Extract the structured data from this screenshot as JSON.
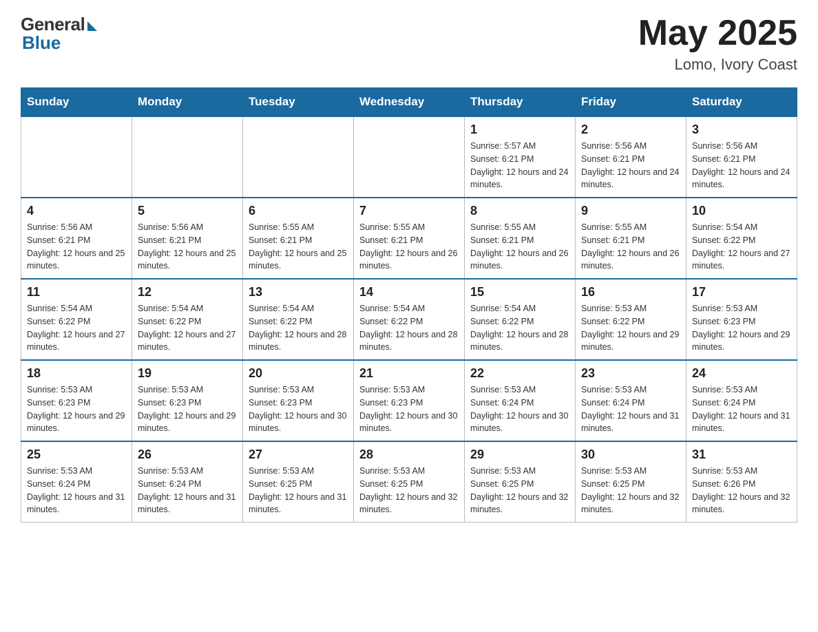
{
  "header": {
    "logo_general": "General",
    "logo_blue": "Blue",
    "month_year": "May 2025",
    "location": "Lomo, Ivory Coast"
  },
  "weekdays": [
    "Sunday",
    "Monday",
    "Tuesday",
    "Wednesday",
    "Thursday",
    "Friday",
    "Saturday"
  ],
  "weeks": [
    [
      {
        "day": "",
        "sunrise": "",
        "sunset": "",
        "daylight": ""
      },
      {
        "day": "",
        "sunrise": "",
        "sunset": "",
        "daylight": ""
      },
      {
        "day": "",
        "sunrise": "",
        "sunset": "",
        "daylight": ""
      },
      {
        "day": "",
        "sunrise": "",
        "sunset": "",
        "daylight": ""
      },
      {
        "day": "1",
        "sunrise": "Sunrise: 5:57 AM",
        "sunset": "Sunset: 6:21 PM",
        "daylight": "Daylight: 12 hours and 24 minutes."
      },
      {
        "day": "2",
        "sunrise": "Sunrise: 5:56 AM",
        "sunset": "Sunset: 6:21 PM",
        "daylight": "Daylight: 12 hours and 24 minutes."
      },
      {
        "day": "3",
        "sunrise": "Sunrise: 5:56 AM",
        "sunset": "Sunset: 6:21 PM",
        "daylight": "Daylight: 12 hours and 24 minutes."
      }
    ],
    [
      {
        "day": "4",
        "sunrise": "Sunrise: 5:56 AM",
        "sunset": "Sunset: 6:21 PM",
        "daylight": "Daylight: 12 hours and 25 minutes."
      },
      {
        "day": "5",
        "sunrise": "Sunrise: 5:56 AM",
        "sunset": "Sunset: 6:21 PM",
        "daylight": "Daylight: 12 hours and 25 minutes."
      },
      {
        "day": "6",
        "sunrise": "Sunrise: 5:55 AM",
        "sunset": "Sunset: 6:21 PM",
        "daylight": "Daylight: 12 hours and 25 minutes."
      },
      {
        "day": "7",
        "sunrise": "Sunrise: 5:55 AM",
        "sunset": "Sunset: 6:21 PM",
        "daylight": "Daylight: 12 hours and 26 minutes."
      },
      {
        "day": "8",
        "sunrise": "Sunrise: 5:55 AM",
        "sunset": "Sunset: 6:21 PM",
        "daylight": "Daylight: 12 hours and 26 minutes."
      },
      {
        "day": "9",
        "sunrise": "Sunrise: 5:55 AM",
        "sunset": "Sunset: 6:21 PM",
        "daylight": "Daylight: 12 hours and 26 minutes."
      },
      {
        "day": "10",
        "sunrise": "Sunrise: 5:54 AM",
        "sunset": "Sunset: 6:22 PM",
        "daylight": "Daylight: 12 hours and 27 minutes."
      }
    ],
    [
      {
        "day": "11",
        "sunrise": "Sunrise: 5:54 AM",
        "sunset": "Sunset: 6:22 PM",
        "daylight": "Daylight: 12 hours and 27 minutes."
      },
      {
        "day": "12",
        "sunrise": "Sunrise: 5:54 AM",
        "sunset": "Sunset: 6:22 PM",
        "daylight": "Daylight: 12 hours and 27 minutes."
      },
      {
        "day": "13",
        "sunrise": "Sunrise: 5:54 AM",
        "sunset": "Sunset: 6:22 PM",
        "daylight": "Daylight: 12 hours and 28 minutes."
      },
      {
        "day": "14",
        "sunrise": "Sunrise: 5:54 AM",
        "sunset": "Sunset: 6:22 PM",
        "daylight": "Daylight: 12 hours and 28 minutes."
      },
      {
        "day": "15",
        "sunrise": "Sunrise: 5:54 AM",
        "sunset": "Sunset: 6:22 PM",
        "daylight": "Daylight: 12 hours and 28 minutes."
      },
      {
        "day": "16",
        "sunrise": "Sunrise: 5:53 AM",
        "sunset": "Sunset: 6:22 PM",
        "daylight": "Daylight: 12 hours and 29 minutes."
      },
      {
        "day": "17",
        "sunrise": "Sunrise: 5:53 AM",
        "sunset": "Sunset: 6:23 PM",
        "daylight": "Daylight: 12 hours and 29 minutes."
      }
    ],
    [
      {
        "day": "18",
        "sunrise": "Sunrise: 5:53 AM",
        "sunset": "Sunset: 6:23 PM",
        "daylight": "Daylight: 12 hours and 29 minutes."
      },
      {
        "day": "19",
        "sunrise": "Sunrise: 5:53 AM",
        "sunset": "Sunset: 6:23 PM",
        "daylight": "Daylight: 12 hours and 29 minutes."
      },
      {
        "day": "20",
        "sunrise": "Sunrise: 5:53 AM",
        "sunset": "Sunset: 6:23 PM",
        "daylight": "Daylight: 12 hours and 30 minutes."
      },
      {
        "day": "21",
        "sunrise": "Sunrise: 5:53 AM",
        "sunset": "Sunset: 6:23 PM",
        "daylight": "Daylight: 12 hours and 30 minutes."
      },
      {
        "day": "22",
        "sunrise": "Sunrise: 5:53 AM",
        "sunset": "Sunset: 6:24 PM",
        "daylight": "Daylight: 12 hours and 30 minutes."
      },
      {
        "day": "23",
        "sunrise": "Sunrise: 5:53 AM",
        "sunset": "Sunset: 6:24 PM",
        "daylight": "Daylight: 12 hours and 31 minutes."
      },
      {
        "day": "24",
        "sunrise": "Sunrise: 5:53 AM",
        "sunset": "Sunset: 6:24 PM",
        "daylight": "Daylight: 12 hours and 31 minutes."
      }
    ],
    [
      {
        "day": "25",
        "sunrise": "Sunrise: 5:53 AM",
        "sunset": "Sunset: 6:24 PM",
        "daylight": "Daylight: 12 hours and 31 minutes."
      },
      {
        "day": "26",
        "sunrise": "Sunrise: 5:53 AM",
        "sunset": "Sunset: 6:24 PM",
        "daylight": "Daylight: 12 hours and 31 minutes."
      },
      {
        "day": "27",
        "sunrise": "Sunrise: 5:53 AM",
        "sunset": "Sunset: 6:25 PM",
        "daylight": "Daylight: 12 hours and 31 minutes."
      },
      {
        "day": "28",
        "sunrise": "Sunrise: 5:53 AM",
        "sunset": "Sunset: 6:25 PM",
        "daylight": "Daylight: 12 hours and 32 minutes."
      },
      {
        "day": "29",
        "sunrise": "Sunrise: 5:53 AM",
        "sunset": "Sunset: 6:25 PM",
        "daylight": "Daylight: 12 hours and 32 minutes."
      },
      {
        "day": "30",
        "sunrise": "Sunrise: 5:53 AM",
        "sunset": "Sunset: 6:25 PM",
        "daylight": "Daylight: 12 hours and 32 minutes."
      },
      {
        "day": "31",
        "sunrise": "Sunrise: 5:53 AM",
        "sunset": "Sunset: 6:26 PM",
        "daylight": "Daylight: 12 hours and 32 minutes."
      }
    ]
  ]
}
